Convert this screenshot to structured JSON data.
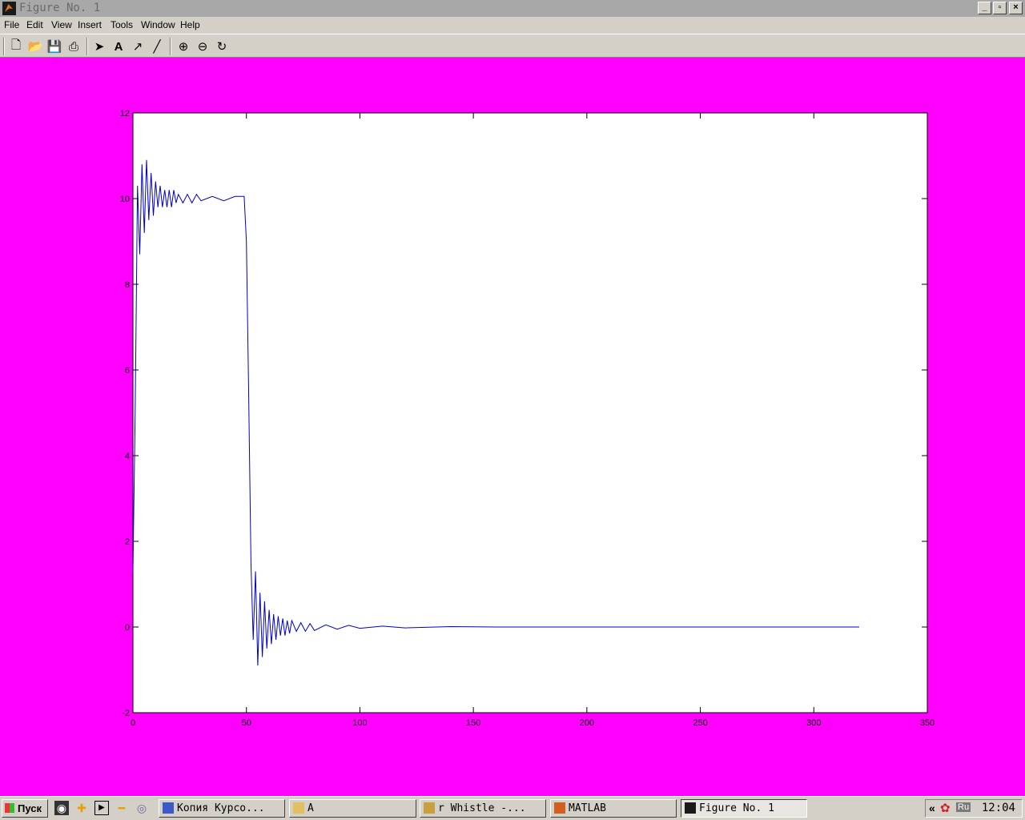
{
  "window": {
    "title": "Figure No. 1"
  },
  "menu": [
    "File",
    "Edit",
    "View",
    "Insert",
    "Tools",
    "Window",
    "Help"
  ],
  "toolbar": [
    "new-file-icon",
    "open-folder-icon",
    "save-icon",
    "print-icon",
    "select-arrow-icon",
    "text-insert-icon",
    "arrow-insert-icon",
    "line-insert-icon",
    "zoom-in-icon",
    "zoom-out-icon",
    "rotate-icon"
  ],
  "colors": {
    "figure_bg": "#ff00ff",
    "axes_bg": "#ffffff",
    "line": "#0000c8"
  },
  "chart_data": {
    "type": "line",
    "title": "",
    "xlabel": "",
    "ylabel": "",
    "xlim": [
      0,
      350
    ],
    "ylim": [
      -2,
      12
    ],
    "xticks": [
      0,
      50,
      100,
      150,
      200,
      250,
      300,
      350
    ],
    "yticks": [
      -2,
      0,
      2,
      4,
      6,
      8,
      10,
      12
    ],
    "series": [
      {
        "x": [
          0,
          1,
          2,
          3,
          4,
          5,
          6,
          7,
          8,
          9,
          10,
          11,
          12,
          13,
          14,
          15,
          16,
          17,
          18,
          19,
          20,
          22,
          24,
          26,
          28,
          30,
          35,
          40,
          45,
          49,
          50,
          51,
          52,
          53,
          54,
          55,
          56,
          57,
          58,
          59,
          60,
          61,
          62,
          63,
          64,
          65,
          66,
          67,
          68,
          69,
          70,
          72,
          74,
          76,
          78,
          80,
          85,
          90,
          95,
          100,
          110,
          120,
          140,
          160,
          175,
          200,
          250,
          300,
          320
        ],
        "y": [
          1.3,
          5.0,
          10.3,
          8.7,
          10.8,
          9.2,
          10.9,
          9.5,
          10.6,
          9.6,
          10.4,
          9.8,
          10.3,
          9.8,
          10.2,
          9.8,
          10.2,
          9.8,
          10.2,
          9.9,
          10.1,
          9.9,
          10.1,
          9.9,
          10.1,
          9.95,
          10.05,
          9.95,
          10.05,
          10.05,
          9.0,
          5.5,
          1.5,
          -0.3,
          1.3,
          -0.9,
          0.8,
          -0.7,
          0.6,
          -0.5,
          0.4,
          -0.4,
          0.3,
          -0.3,
          0.25,
          -0.2,
          0.2,
          -0.2,
          0.15,
          -0.15,
          0.15,
          -0.1,
          0.1,
          -0.1,
          0.08,
          -0.08,
          0.05,
          -0.05,
          0.04,
          -0.03,
          0.02,
          -0.02,
          0.01,
          0,
          0,
          0,
          0,
          0,
          0
        ]
      }
    ]
  },
  "taskbar": {
    "start": "Пуск",
    "tasks": [
      "Копия Курсо...",
      "A",
      "r Whistle -...",
      "MATLAB",
      "Figure No. 1"
    ],
    "tray_lang": "Ru",
    "clock": "12:04"
  }
}
